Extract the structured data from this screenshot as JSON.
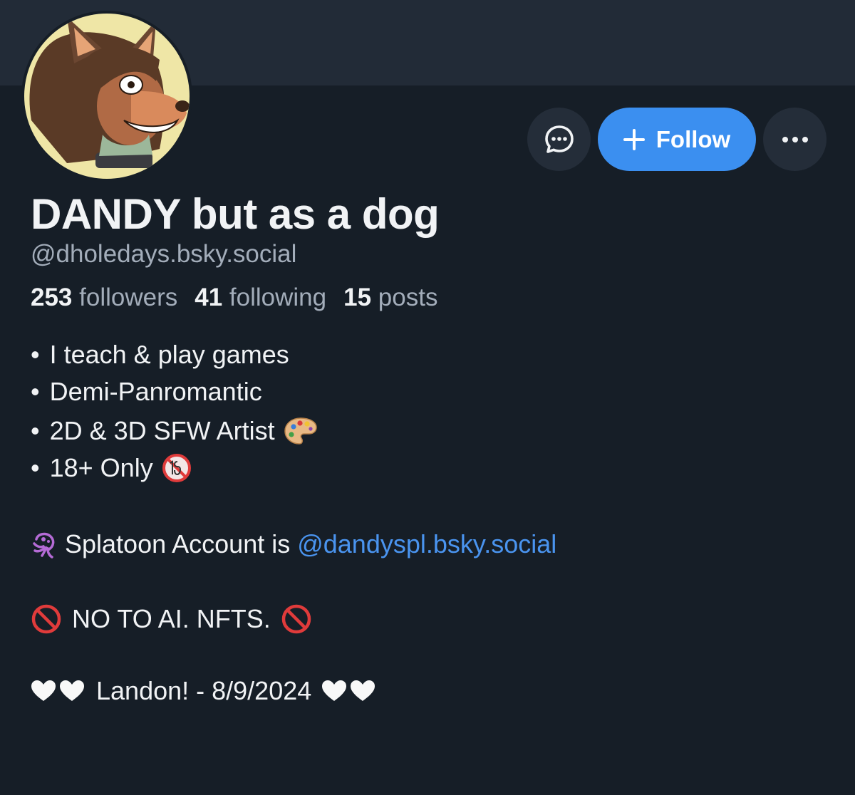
{
  "profile": {
    "display_name": "DANDY but as a dog",
    "handle": "@dholedays.bsky.social",
    "avatar_icon": "dog-character-avatar"
  },
  "actions": {
    "message_icon": "chat-bubble-icon",
    "follow_label": "Follow",
    "more_icon": "more-dots-icon"
  },
  "stats": {
    "followers_count": "253",
    "followers_label": "followers",
    "following_count": "41",
    "following_label": "following",
    "posts_count": "15",
    "posts_label": "posts"
  },
  "bio": {
    "bullet": "•",
    "line1": "I teach & play games",
    "line2": "Demi-Panromantic",
    "line3": "2D & 3D SFW Artist",
    "line4": "18+ Only",
    "splatoon_text": "Splatoon Account is ",
    "splatoon_link": "@dandyspl.bsky.social",
    "no_ai_text": "NO TO AI. NFTS.",
    "landon_text": "Landon! - 8/9/2024"
  },
  "colors": {
    "background": "#161e27",
    "banner": "#222b37",
    "accent": "#3b8ff0",
    "link": "#4a94ef",
    "muted": "#a3adba"
  }
}
